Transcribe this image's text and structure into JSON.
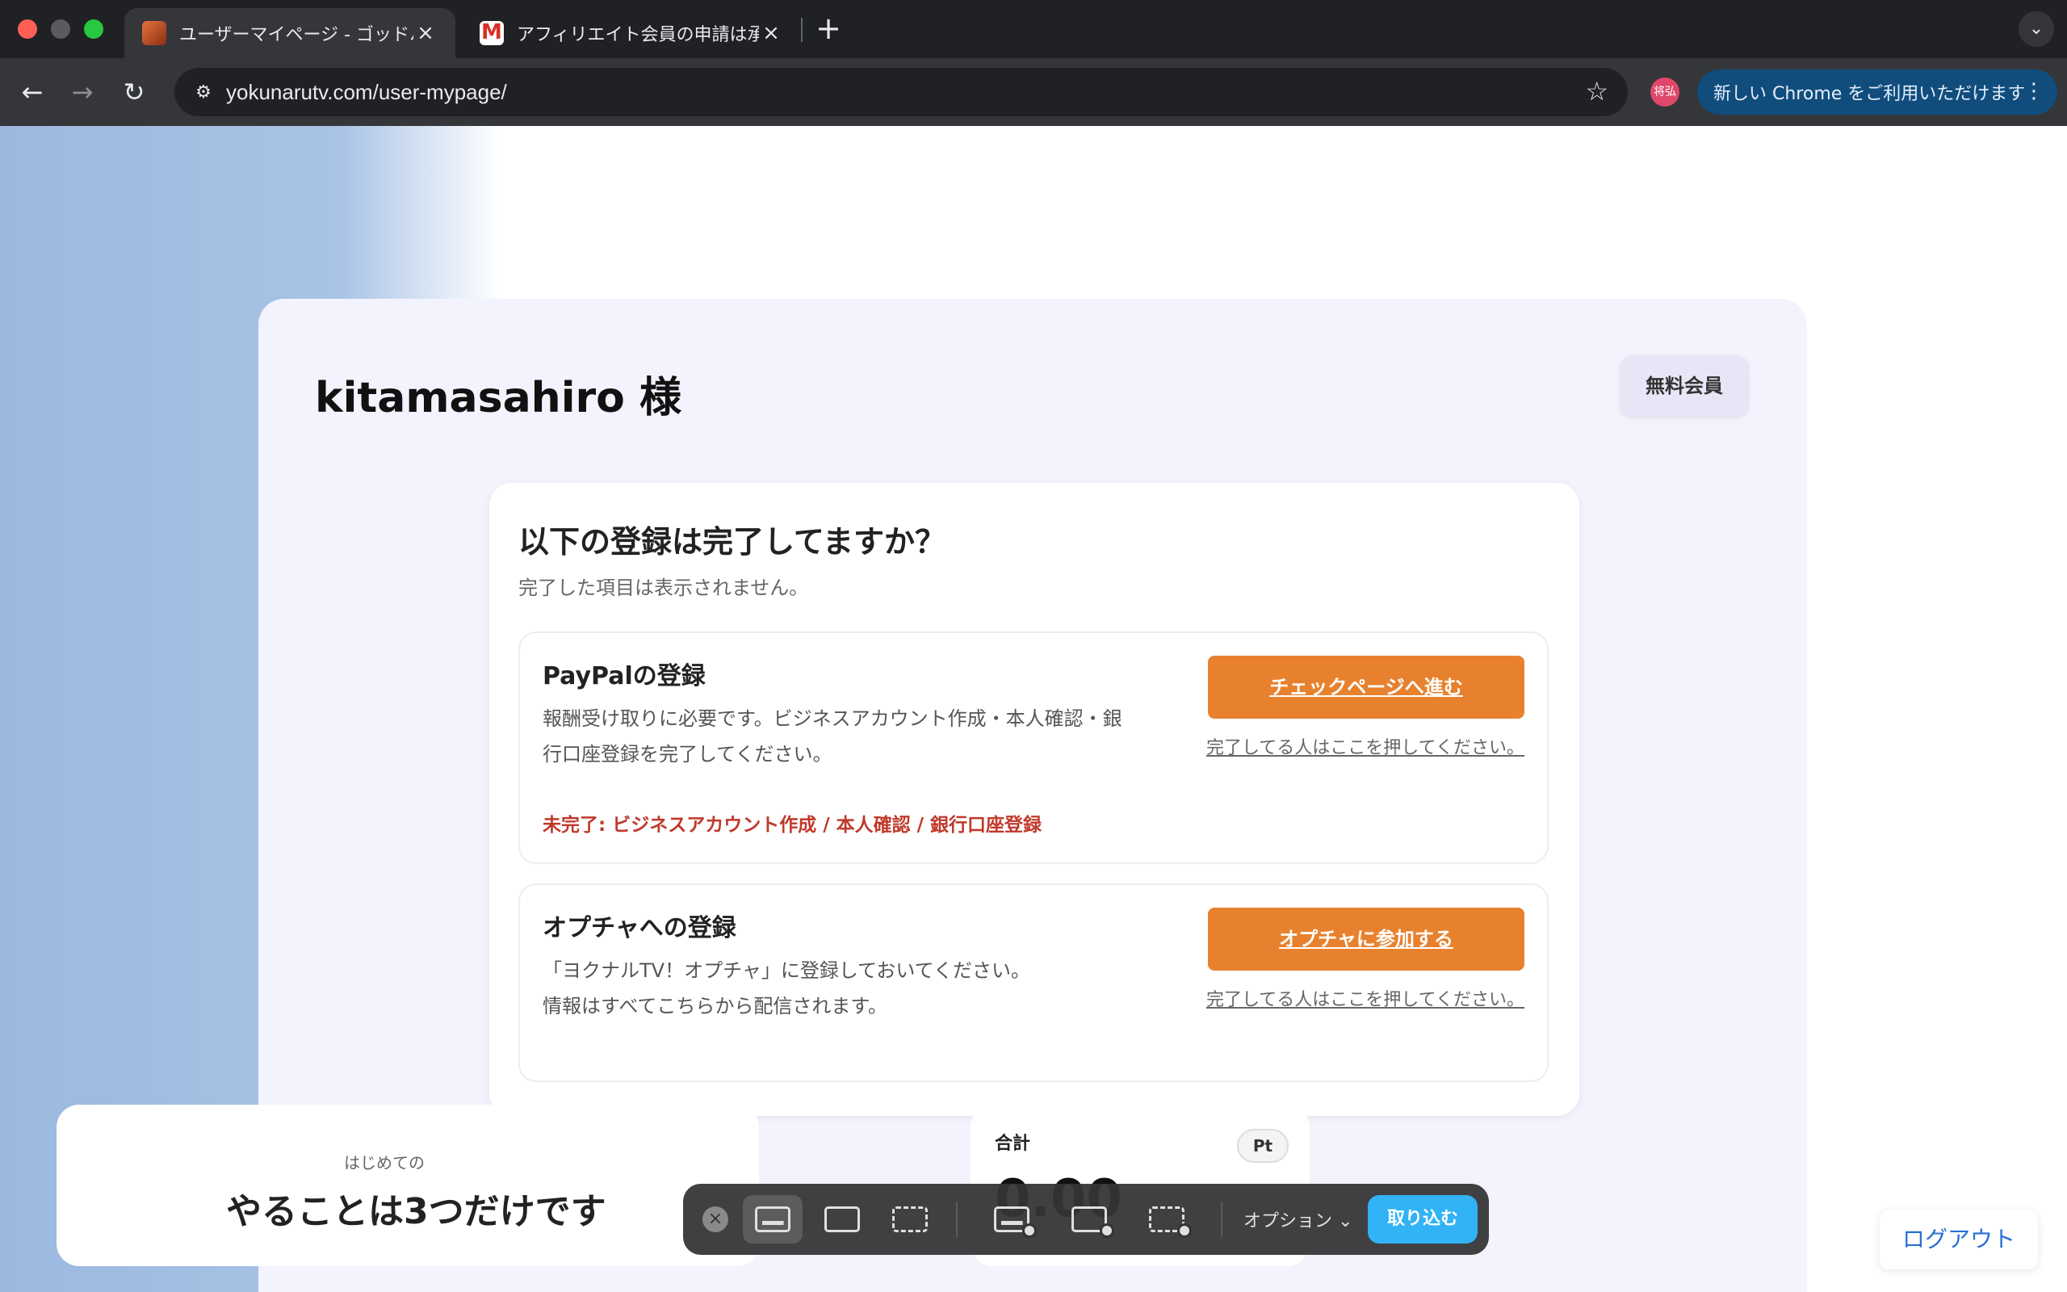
{
  "browser": {
    "tabs": [
      {
        "title": "ユーザーマイページ - ゴッドハンド",
        "active": true
      },
      {
        "title": "アフィリエイト会員の申請は承認",
        "active": false
      }
    ],
    "new_tab_glyph": "+",
    "url": "yokunarutv.com/user-mypage/",
    "profile_initials": "将弘",
    "update_chip_label": "新しい Chrome をご利用いただけます",
    "update_chip_menu": "⋮"
  },
  "page": {
    "username": "kitamasahiro 様",
    "membership_badge": "無料会員",
    "registration": {
      "title": "以下の登録は完了してますか？",
      "subtitle": "完了した項目は表示されません。",
      "items": [
        {
          "title": "PayPalの登録",
          "desc_lines": [
            "報酬受け取りに必要です。ビジネスアカウント作成・本人確認・銀",
            "行口座登録を完了してください。"
          ],
          "warning": "未完了: ビジネスアカウント作成 / 本人確認 / 銀行口座登録",
          "cta_label": "チェックページへ進む",
          "done_link": "完了してる人はここを押してください。"
        },
        {
          "title": "オプチャへの登録",
          "desc_lines": [
            "「ヨクナルTV！オプチャ」に登録しておいてください。",
            "情報はすべてこちらから配信されます。"
          ],
          "cta_label": "オプチャに参加する",
          "done_link": "完了してる人はここを押してください。"
        }
      ]
    },
    "intro_card": {
      "subtitle": "はじめての",
      "title": "やることは3つだけです"
    },
    "points_card": {
      "label": "合計",
      "unit_chip": "Pt",
      "value": "0.00"
    },
    "logout_label": "ログアウト"
  },
  "screenshot_toolbar": {
    "options_label": "オプション ⌄",
    "capture_label": "取り込む"
  },
  "colors": {
    "accent_orange": "#e8812e",
    "warning_red": "#c0392b",
    "link_blue": "#2a6fd6",
    "capture_blue": "#31b3f5"
  }
}
